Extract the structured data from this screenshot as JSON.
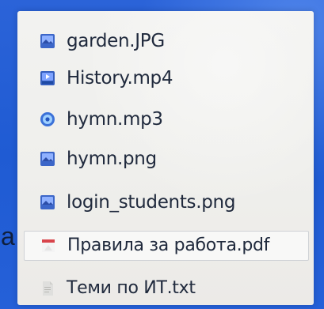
{
  "window": {
    "side_letter": "a"
  },
  "file_list": {
    "items": [
      {
        "name": "garden.JPG",
        "icon": "image-file-icon"
      },
      {
        "name": "History.mp4",
        "icon": "video-file-icon"
      },
      {
        "name": "hymn.mp3",
        "icon": "audio-file-icon"
      },
      {
        "name": "hymn.png",
        "icon": "image-file-icon"
      },
      {
        "name": "login_students.png",
        "icon": "image-file-icon"
      },
      {
        "name": "Правила за работа.pdf",
        "icon": "pdf-file-icon",
        "selected": true
      },
      {
        "name": "Теми по ИТ.txt",
        "icon": "text-file-icon"
      }
    ]
  },
  "colors": {
    "desktop_blue": "#1f5fd6",
    "panel_bg": "#efefec",
    "text": "#202a3d",
    "selection_border": "#cfd2d6",
    "pdf_red": "#d8444b"
  }
}
